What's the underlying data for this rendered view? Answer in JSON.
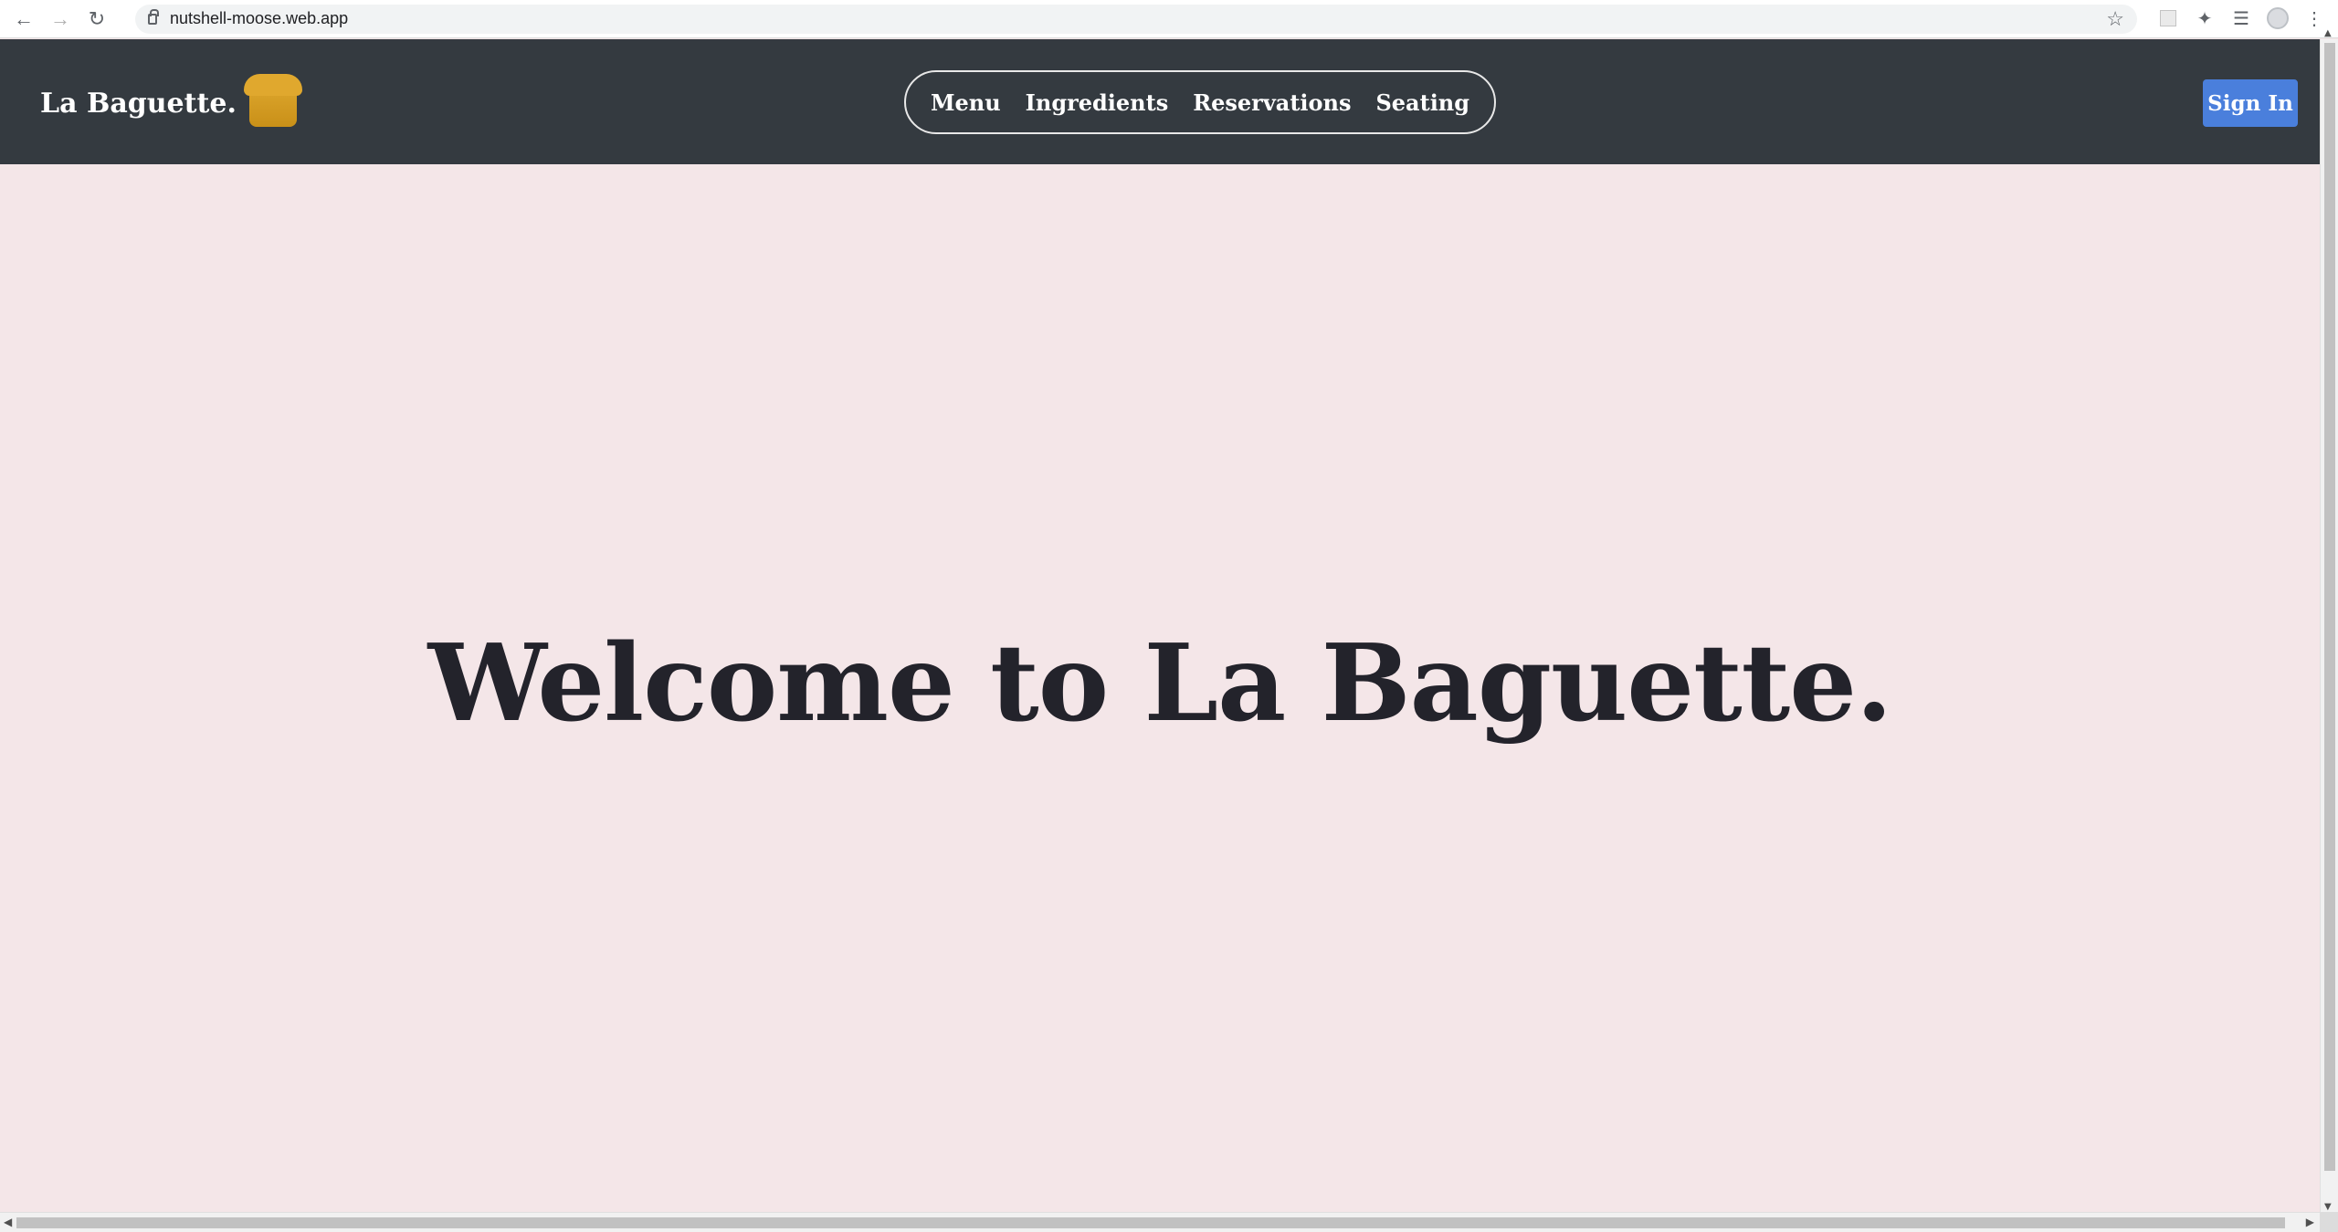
{
  "browser": {
    "url": "nutshell-moose.web.app"
  },
  "header": {
    "brand": "La Baguette.",
    "nav": [
      "Menu",
      "Ingredients",
      "Reservations",
      "Seating"
    ],
    "sign_in": "Sign In"
  },
  "hero": {
    "title": "Welcome to La Baguette."
  },
  "colors": {
    "header_bg": "#343a40",
    "page_bg": "#f4e6e8",
    "accent": "#4a7fdc",
    "bread": "#dca52c"
  }
}
